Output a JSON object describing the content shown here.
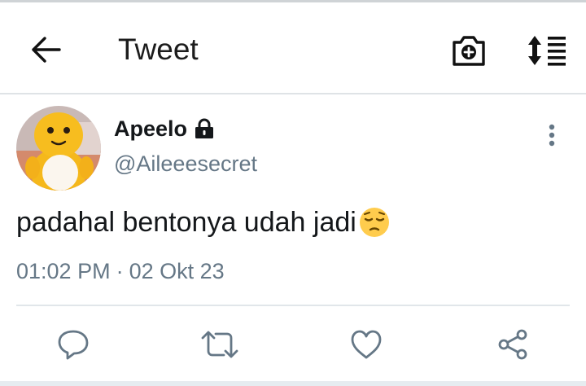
{
  "header": {
    "title": "Tweet",
    "icons": {
      "back": "back-arrow-icon",
      "camera": "camera-add-icon",
      "sort": "sort-list-icon"
    }
  },
  "tweet": {
    "display_name": "Apeelo",
    "handle": "@Aileeesecret",
    "text": "padahal bentonya udah jadi",
    "emoji": "pensive-face-emoji",
    "time": "01:02 PM",
    "separator": "·",
    "date": "02 Okt 23",
    "protected_icon": "lock-icon"
  },
  "actions": {
    "icons": [
      "reply-icon",
      "retweet-icon",
      "like-icon",
      "share-icon"
    ]
  },
  "colors": {
    "text": "#14171a",
    "secondary_text": "#657786",
    "action_icon": "#657786",
    "divider": "#e1e6ea"
  }
}
